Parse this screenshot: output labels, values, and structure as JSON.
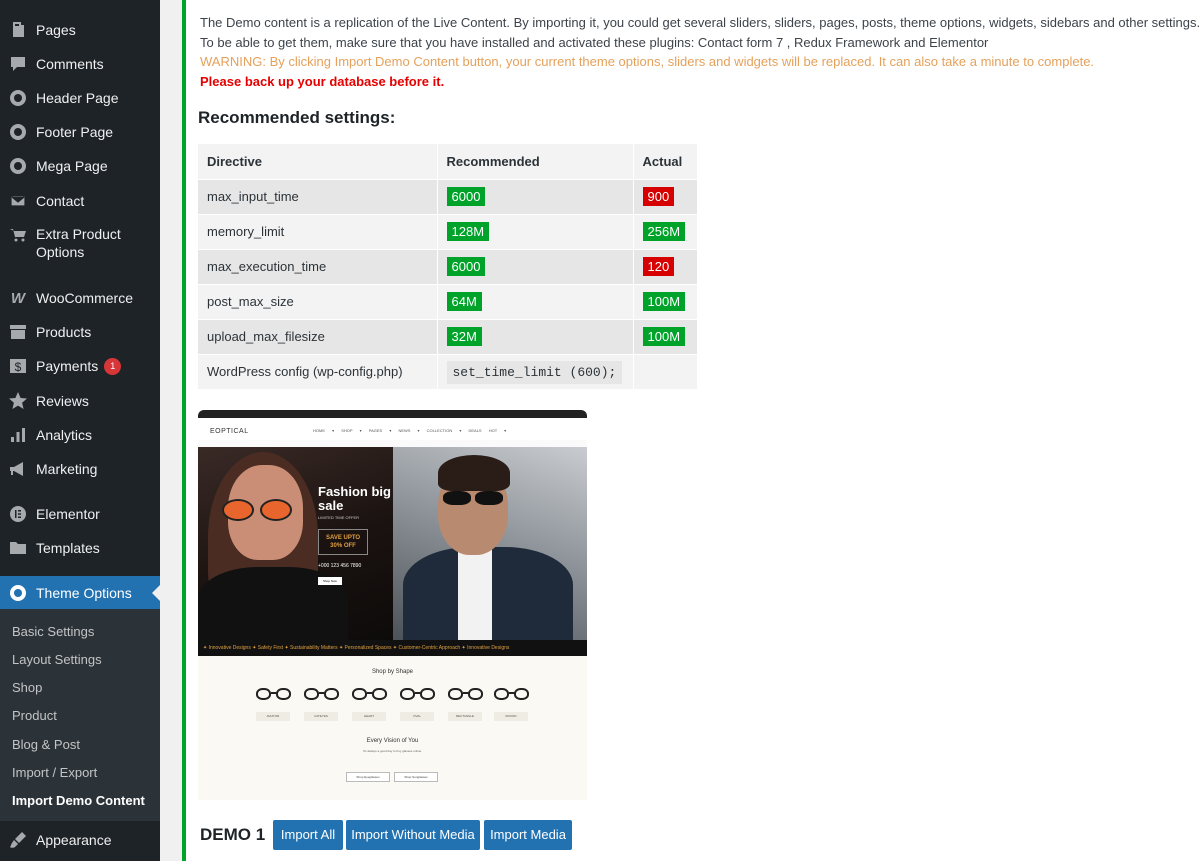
{
  "sidebar": {
    "items": [
      {
        "label": "Pages",
        "icon": "pages-icon"
      },
      {
        "label": "Comments",
        "icon": "comments-icon"
      },
      {
        "label": "Header Page",
        "icon": "theme-logo-icon"
      },
      {
        "label": "Footer Page",
        "icon": "theme-logo-icon"
      },
      {
        "label": "Mega Page",
        "icon": "theme-logo-icon"
      },
      {
        "label": "Contact",
        "icon": "envelope-icon"
      },
      {
        "label": "Extra Product",
        "label2": "Options",
        "icon": "cart-icon"
      },
      {
        "label": "WooCommerce",
        "icon": "woocommerce-icon"
      },
      {
        "label": "Products",
        "icon": "archive-icon"
      },
      {
        "label": "Payments",
        "icon": "dollar-icon",
        "badge": "1"
      },
      {
        "label": "Reviews",
        "icon": "star-icon"
      },
      {
        "label": "Analytics",
        "icon": "bar-chart-icon"
      },
      {
        "label": "Marketing",
        "icon": "megaphone-icon"
      },
      {
        "label": "Elementor",
        "icon": "elementor-icon"
      },
      {
        "label": "Templates",
        "icon": "folder-icon"
      },
      {
        "label": "Theme Options",
        "icon": "theme-logo-icon"
      },
      {
        "label": "Appearance",
        "icon": "brush-icon"
      }
    ],
    "submenu": [
      "Basic Settings",
      "Layout Settings",
      "Shop",
      "Product",
      "Blog & Post",
      "Import / Export",
      "Import Demo Content"
    ]
  },
  "content": {
    "desc1": "The Demo content is a replication of the Live Content. By importing it, you could get several sliders, sliders, pages, posts, theme options, widgets, sidebars and other settings.",
    "desc2": "To be able to get them, make sure that you have installed and activated these plugins: Contact form 7 , Redux Framework and Elementor",
    "warning": "WARNING: By clicking Import Demo Content button, your current theme options, sliders and widgets will be replaced. It can also take a minute to complete.",
    "backup": "Please back up your database before it.",
    "rec_title": "Recommended settings:",
    "table": {
      "headers": [
        "Directive",
        "Recommended",
        "Actual"
      ],
      "rows": [
        {
          "directive": "max_input_time",
          "recommended": "6000",
          "actual": "900",
          "ok": false
        },
        {
          "directive": "memory_limit",
          "recommended": "128M",
          "actual": "256M",
          "ok": true
        },
        {
          "directive": "max_execution_time",
          "recommended": "6000",
          "actual": "120",
          "ok": false
        },
        {
          "directive": "post_max_size",
          "recommended": "64M",
          "actual": "100M",
          "ok": true
        },
        {
          "directive": "upload_max_filesize",
          "recommended": "32M",
          "actual": "100M",
          "ok": true
        }
      ],
      "config_label": "WordPress config (wp-config.php)",
      "config_code": "set_time_limit (600);"
    },
    "preview": {
      "logo": "EOPTICAL",
      "menu": "HOME ▾ SHOP ▾ PAGES ▾ NEWS ▾ COLLECTION ▾ DEALS HOT ▾",
      "hero_title": "Fashion big sale",
      "hero_sub": "LIMITED TIME OFFER",
      "save": "SAVE UPTO 30% OFF",
      "phone": "+000 123 456 7890",
      "shop_btn": "Shop Now",
      "ticker": "✦ Innovative Designs   ✦ Safety First   ✦ Sustainability Matters   ✦ Personalized Spaces   ✦ Customer-Centric Approach   ✦ Innovative Designs",
      "shop_title": "Shop by Shape",
      "shapes": [
        "AVIATOR",
        "CATEYES",
        "HEART",
        "OVAL",
        "RECTANGLE",
        "ROUND"
      ],
      "vision_title": "Every Vision of You",
      "vision_sub": "It's always a good day to buy glasses online.",
      "btn1": "Shop Eyeglasses",
      "btn2": "Shop Sunglasses"
    },
    "demo_label": "DEMO 1",
    "buttons": [
      "Import All",
      "Import Without Media",
      "Import Media"
    ]
  }
}
